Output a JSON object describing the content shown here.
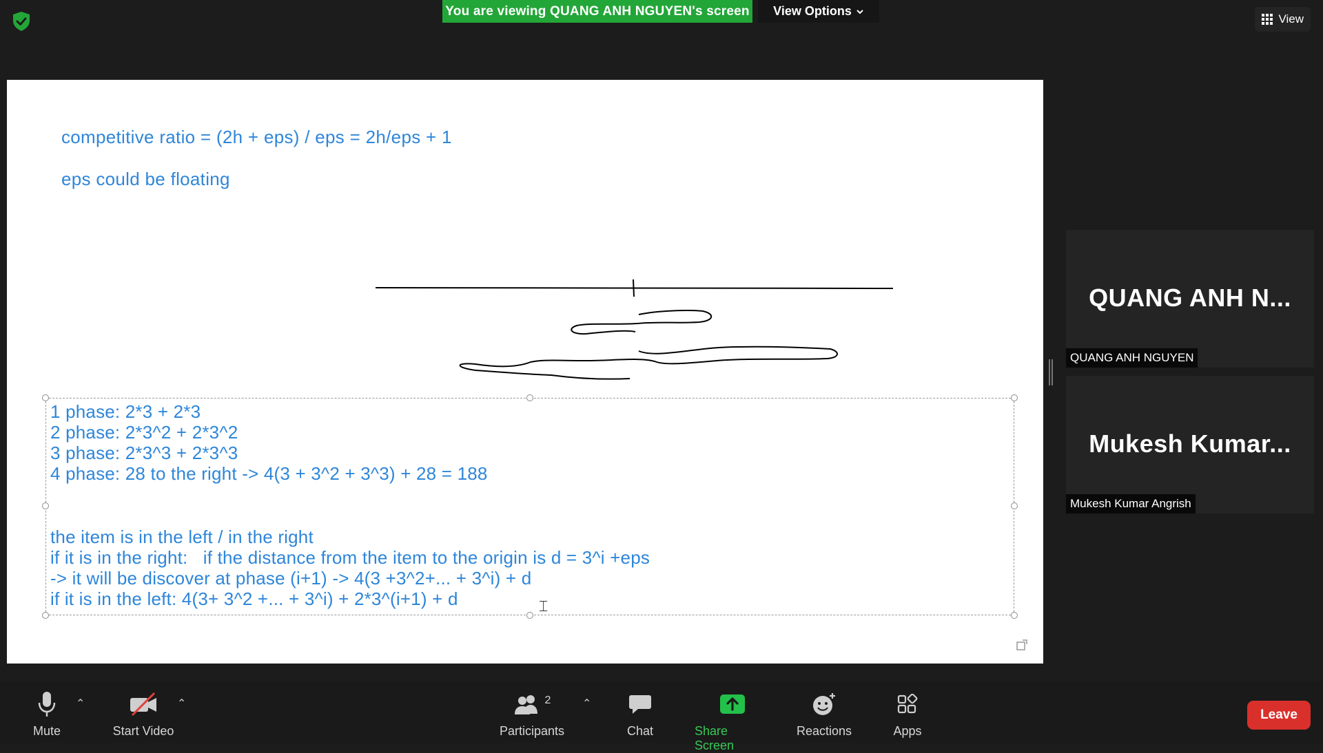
{
  "banner": {
    "sharing_text": "You are viewing QUANG ANH NGUYEN's screen",
    "view_options_label": "View Options",
    "view_label": "View"
  },
  "whiteboard": {
    "notes": [
      "competitive ratio = (2h + eps) / eps = 2h/eps + 1",
      "eps could be floating"
    ],
    "textbox_lines": [
      "1 phase: 2*3 + 2*3",
      "2 phase: 2*3^2 + 2*3^2",
      "3 phase: 2*3^3 + 2*3^3",
      "4 phase: 28 to the right -> 4(3 + 3^2 + 3^3) + 28 = 188",
      "the item is in the left / in the right",
      "if it is in the right:   if the distance from the item to the origin is d = 3^i +eps",
      "-> it will be discover at phase (i+1) -> 4(3 +3^2+... + 3^i) + d",
      "if it is in the left: 4(3+ 3^2 +... + 3^i) + 2*3^(i+1) + d"
    ],
    "text_color": "#2e86d9"
  },
  "participants": [
    {
      "display_name": "QUANG ANH N...",
      "full_name": "QUANG ANH NGUYEN"
    },
    {
      "display_name": "Mukesh Kumar...",
      "full_name": "Mukesh Kumar Angrish"
    }
  ],
  "toolbar": {
    "mute_label": "Mute",
    "start_video_label": "Start Video",
    "participants_label": "Participants",
    "participants_count": "2",
    "chat_label": "Chat",
    "share_screen_label": "Share Screen",
    "reactions_label": "Reactions",
    "apps_label": "Apps",
    "leave_label": "Leave"
  },
  "colors": {
    "share_green": "#23a638",
    "leave_red": "#d9302c",
    "background": "#1c1c1c"
  }
}
